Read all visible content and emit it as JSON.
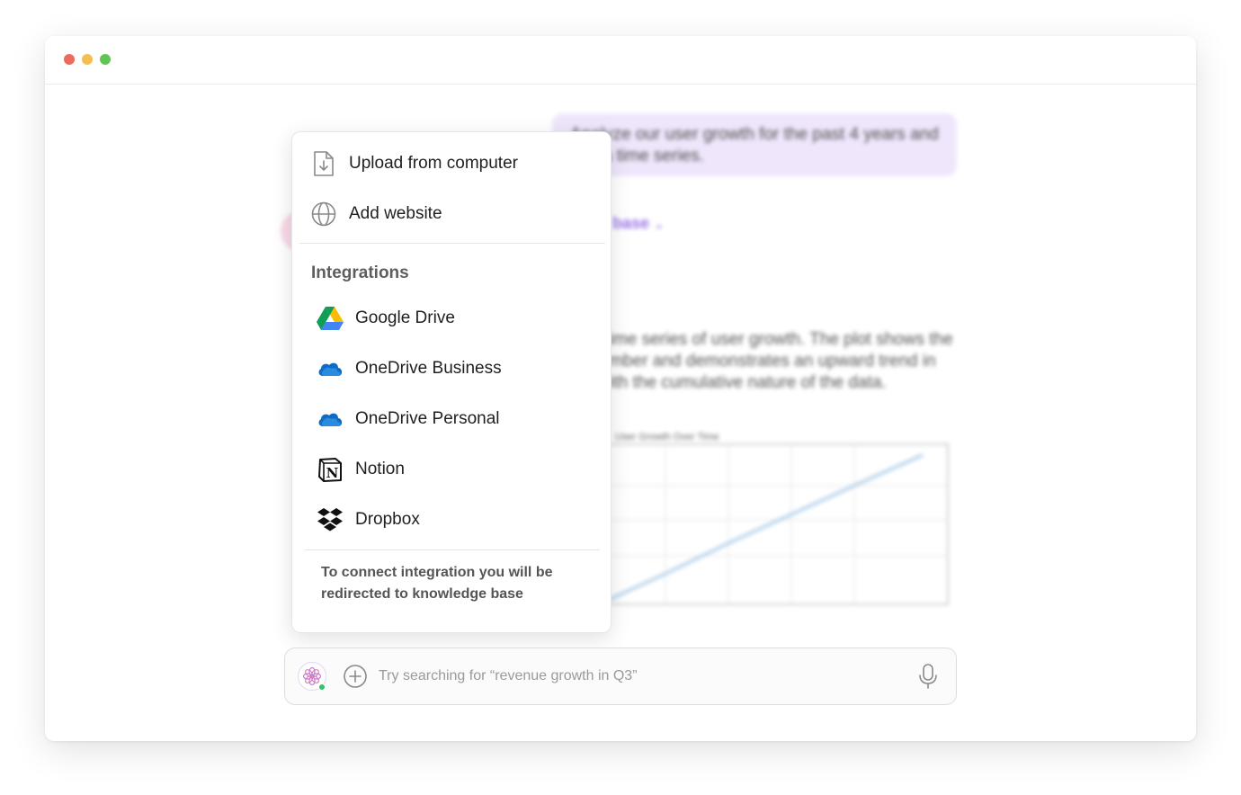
{
  "background_chat": {
    "user_message": "Analyze our user growth for the past 4 years and plot a time series.",
    "source_link": "Knowledge base",
    "answer_text": "I've plotted a time series of user growth. The plot shows the cumulative number and demonstrates an upward trend in user growth with the cumulative nature of the data.",
    "chart_title": "User Growth Over Time"
  },
  "menu": {
    "top_items": [
      {
        "label": "Upload from computer",
        "icon": "file-upload-icon"
      },
      {
        "label": "Add website",
        "icon": "globe-icon"
      }
    ],
    "integrations_label": "Integrations",
    "integrations": [
      {
        "label": "Google Drive",
        "icon": "google-drive-icon"
      },
      {
        "label": "OneDrive Business",
        "icon": "onedrive-icon"
      },
      {
        "label": "OneDrive Personal",
        "icon": "onedrive-icon"
      },
      {
        "label": "Notion",
        "icon": "notion-icon"
      },
      {
        "label": "Dropbox",
        "icon": "dropbox-icon"
      }
    ],
    "footnote": "To connect integration you will be redirected to knowledge base"
  },
  "input_bar": {
    "placeholder": "Try searching for “revenue growth in Q3”",
    "value": ""
  },
  "colors": {
    "accent": "#9a74e8",
    "user_bubble": "#efe6fc",
    "status_online": "#2fc46a"
  }
}
